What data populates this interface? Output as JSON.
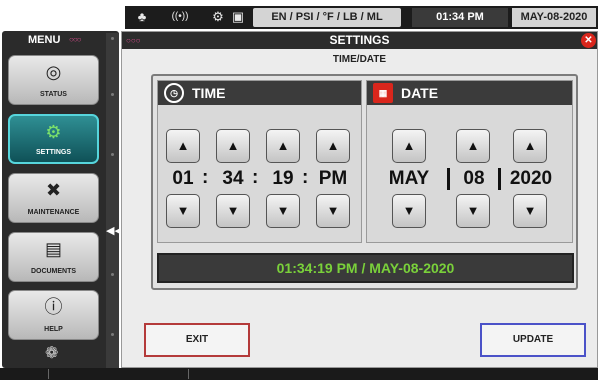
{
  "status_bar": {
    "icons": [
      "leaf-icon",
      "signal-icon",
      "microscope-icon",
      "settings-panel-icon"
    ],
    "units": "EN / PSI / °F / LB / ML",
    "time": "01:34 PM",
    "date": "MAY-08-2020"
  },
  "sidebar": {
    "title": "MENU",
    "items": [
      {
        "label": "STATUS",
        "icon": "gauge-icon",
        "active": false
      },
      {
        "label": "SETTINGS",
        "icon": "gear-icon",
        "active": true
      },
      {
        "label": "MAINTENANCE",
        "icon": "tools-icon",
        "active": false
      },
      {
        "label": "DOCUMENTS",
        "icon": "document-icon",
        "active": false
      },
      {
        "label": "HELP",
        "icon": "help-icon",
        "active": false
      }
    ]
  },
  "window": {
    "title": "SETTINGS",
    "subtitle": "TIME/DATE"
  },
  "time_section": {
    "title": "TIME",
    "hour": "01",
    "minute": "34",
    "second": "19",
    "period": "PM"
  },
  "date_section": {
    "title": "DATE",
    "month": "MAY",
    "day": "08",
    "year": "2020"
  },
  "summary": "01:34:19 PM / MAY-08-2020",
  "buttons": {
    "exit": "EXIT",
    "update": "UPDATE"
  },
  "colors": {
    "active_nav": "#1a6e74",
    "summary_text": "#7ad13a",
    "exit_border": "#b43a3a",
    "update_border": "#4b52c8",
    "close_button": "#d9261c"
  }
}
